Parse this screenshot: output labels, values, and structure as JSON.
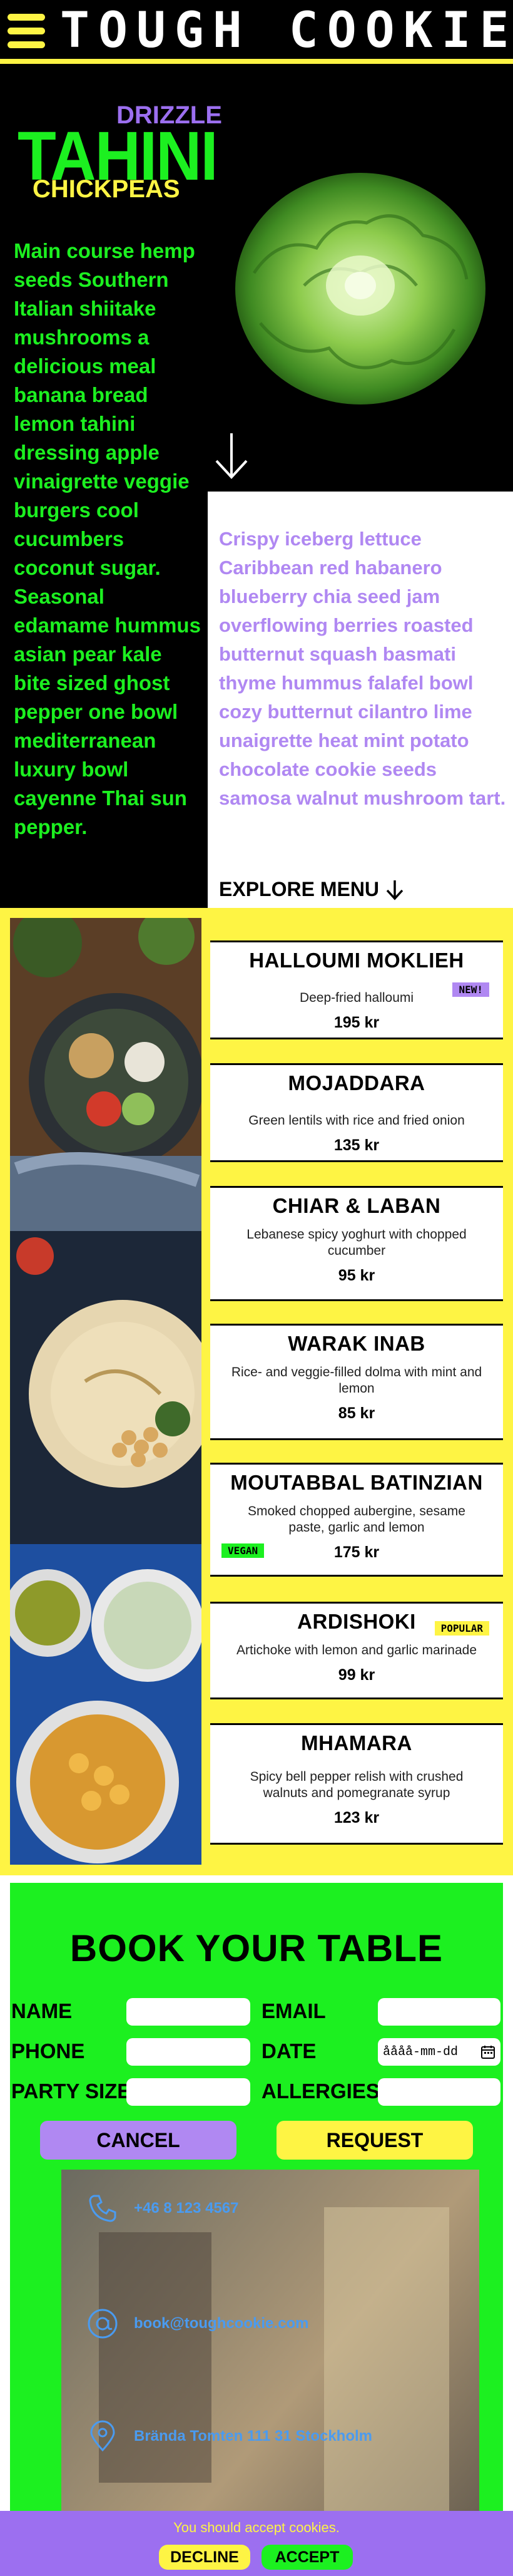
{
  "header": {
    "logo": "TOUGH COOKIE",
    "menu_icon": "hamburger-icon"
  },
  "hero": {
    "drizzle": "DRIZZLE",
    "tahini": "TAHINI",
    "chickpeas": "CHICKPEAS",
    "left_text": "Main course hemp seeds Southern Italian shiitake mushrooms a delicious meal banana bread lemon tahini dressing apple vinaigrette veggie burgers cool cucumbers coconut sugar. Seasonal edamame hummus asian pear kale bite sized ghost pepper one bowl mediterranean luxury bowl cayenne Thai sun pepper.",
    "right_text": "Crispy iceberg lettuce Caribbean red habanero blueberry chia seed jam overflowing berries roasted butternut squash basmati thyme hummus falafel bowl cozy butternut cilantro lime unaigrette heat mint potato chocolate cookie seeds samosa walnut mushroom tart.",
    "explore": "EXPLORE MENU",
    "arrow_icon": "down-arrow-icon"
  },
  "menu": {
    "items": [
      {
        "name": "HALLOUMI MOKLIEH",
        "desc": "Deep-fried halloumi",
        "price": "195 kr",
        "badge": "NEW!"
      },
      {
        "name": "MOJADDARA",
        "desc": "Green lentils with rice and fried onion",
        "price": "135 kr"
      },
      {
        "name": "CHIAR & LABAN",
        "desc": "Lebanese spicy yoghurt with chopped cucumber",
        "price": "95 kr"
      },
      {
        "name": "WARAK INAB",
        "desc": "Rice- and veggie-filled dolma with mint and lemon",
        "price": "85 kr"
      },
      {
        "name": "MOUTABBAL BATINZIAN",
        "desc": "Smoked chopped aubergine, sesame paste, garlic and lemon",
        "price": "175 kr",
        "badge": "VEGAN"
      },
      {
        "name": "ARDISHOKI",
        "desc": "Artichoke with lemon and garlic marinade",
        "price": "99 kr",
        "badge": "POPULAR"
      },
      {
        "name": "MHAMARA",
        "desc": "Spicy bell pepper relish with crushed walnuts and pomegranate syrup",
        "price": "123 kr"
      }
    ]
  },
  "booking": {
    "title": "BOOK YOUR TABLE",
    "name_label": "NAME",
    "email_label": "EMAIL",
    "phone_label": "PHONE",
    "date_label": "DATE",
    "date_value": "åååå-mm-dd",
    "party_label": "PARTY SIZE",
    "allergies_label": "ALLERGIES",
    "cancel": "CANCEL",
    "request": "REQUEST",
    "phone": "+46 8 123 4567",
    "email": "book@toughcookie.com",
    "address": "Brända Tomten 111 31 Stockholm"
  },
  "cookie": {
    "text": "You should accept cookies.",
    "decline": "DECLINE",
    "accept": "ACCEPT"
  },
  "colors": {
    "yellow": "#fef444",
    "green": "#1cf020",
    "purple": "#9c6ff0",
    "blue": "#4a9bf0"
  }
}
